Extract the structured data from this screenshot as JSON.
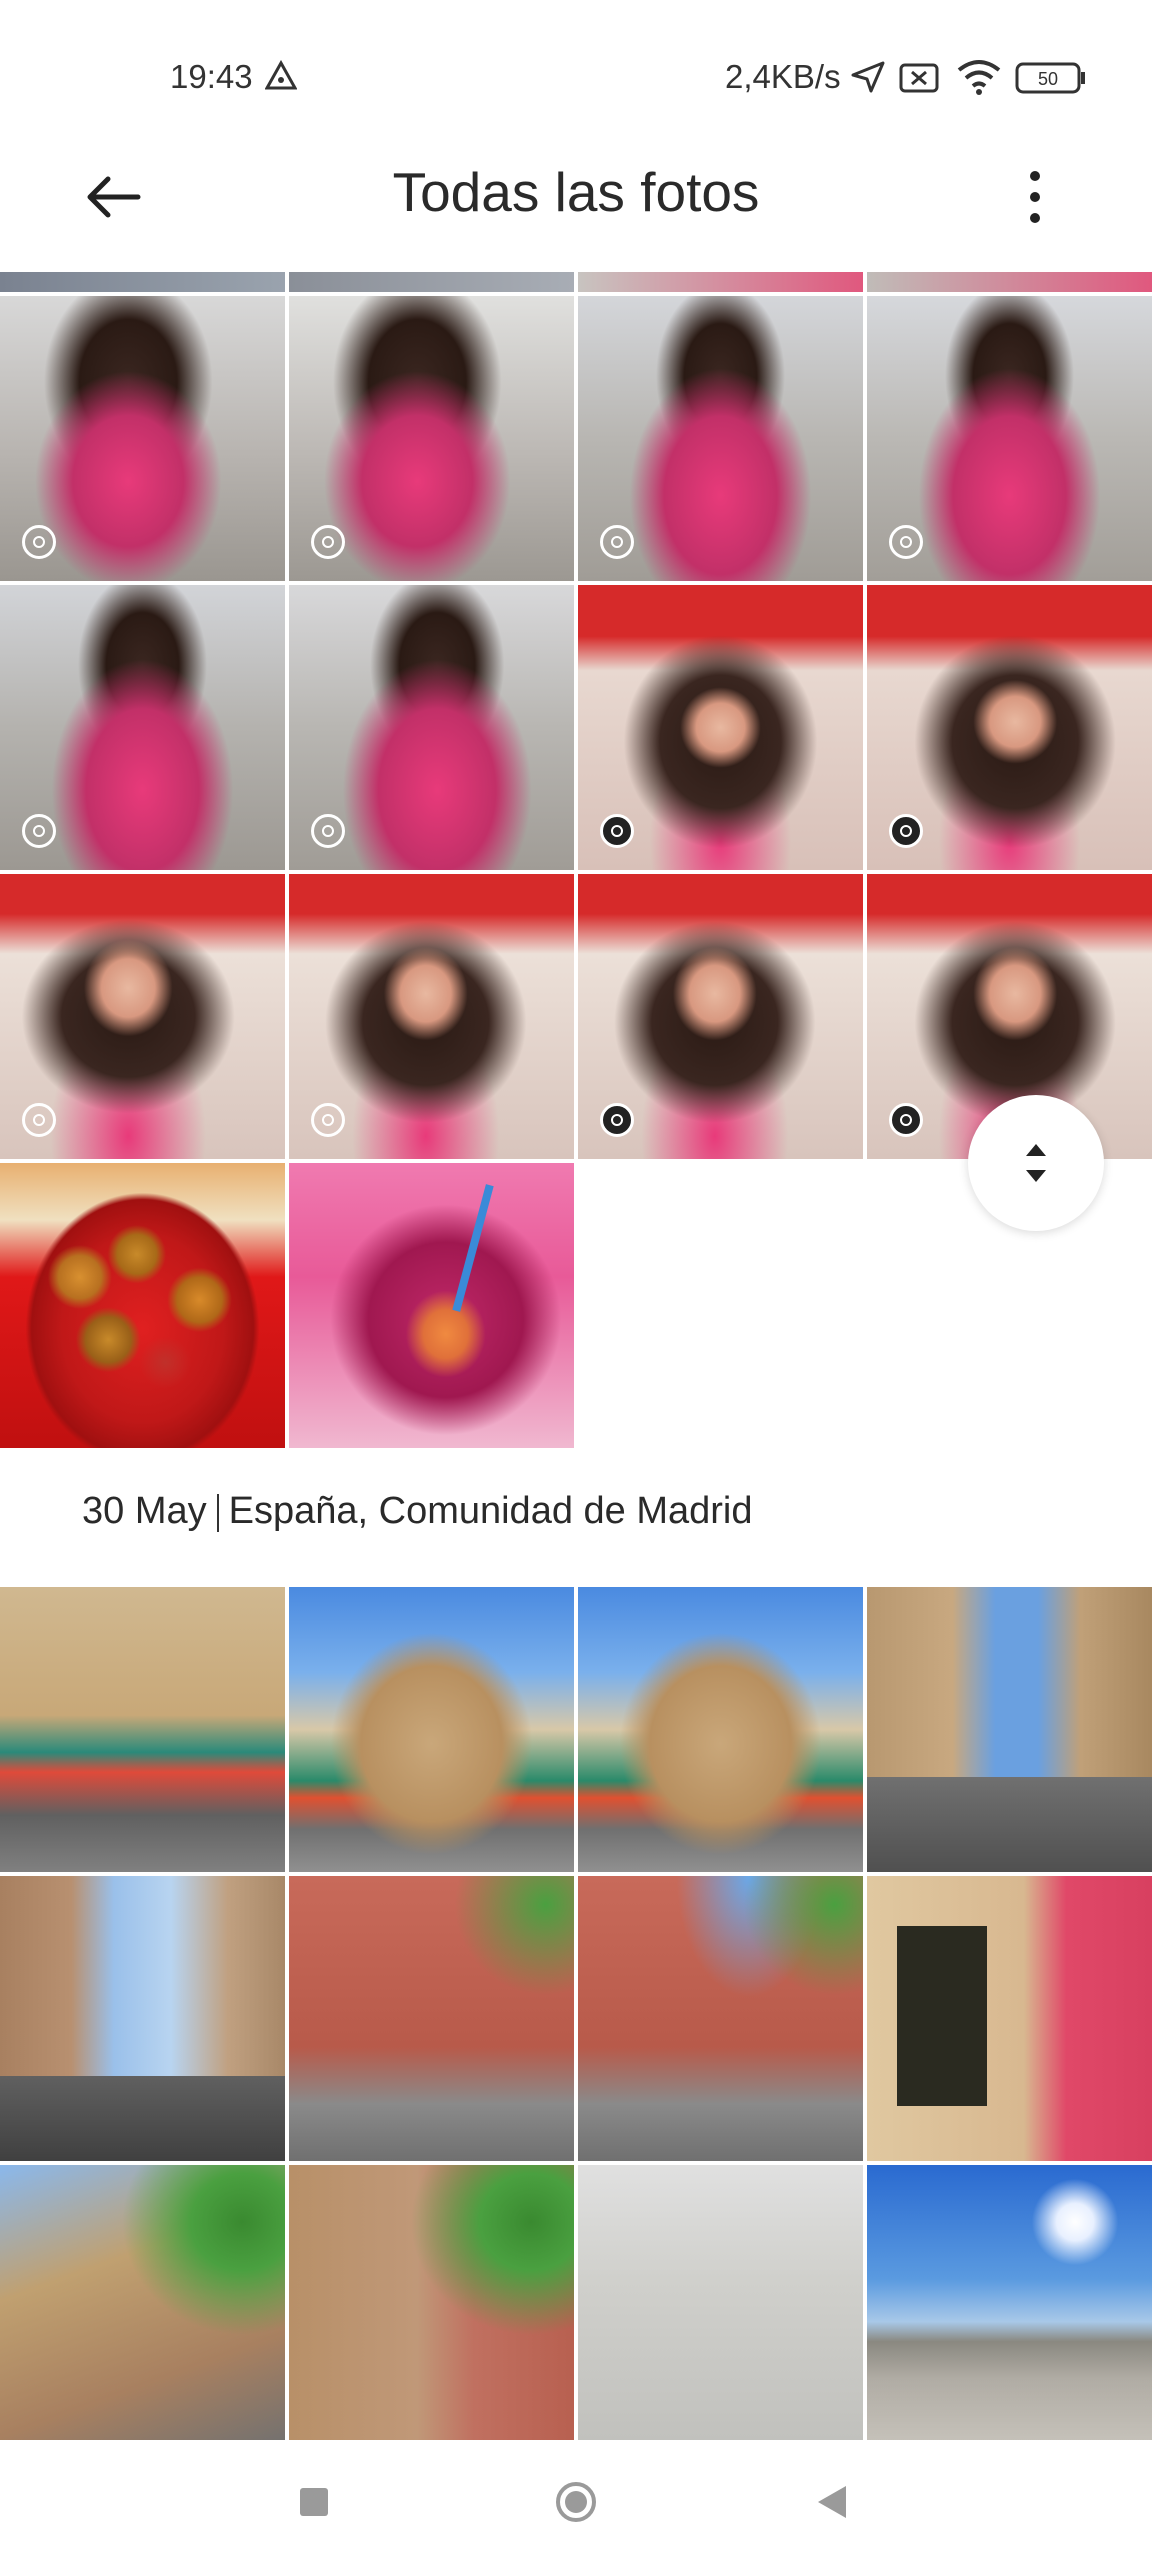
{
  "status_bar": {
    "time": "19:43",
    "network_speed": "2,4KB/s",
    "battery": "50"
  },
  "app_bar": {
    "title": "Todas las fotos",
    "back_icon": "arrow-left-icon",
    "more_icon": "more-vertical-icon"
  },
  "section": {
    "date": "30 May",
    "location": "España, Comunidad de Madrid"
  },
  "nav_bar": {
    "recents_icon": "square-icon",
    "home_icon": "circle-icon",
    "back_icon": "triangle-back-icon"
  },
  "colors": {
    "pink_dress": "#e83a7a",
    "awning_red": "#d62a2a",
    "sky_blue": "#5a9ae0",
    "building_tan": "#c9a77a",
    "brick_red": "#b85a4a"
  }
}
